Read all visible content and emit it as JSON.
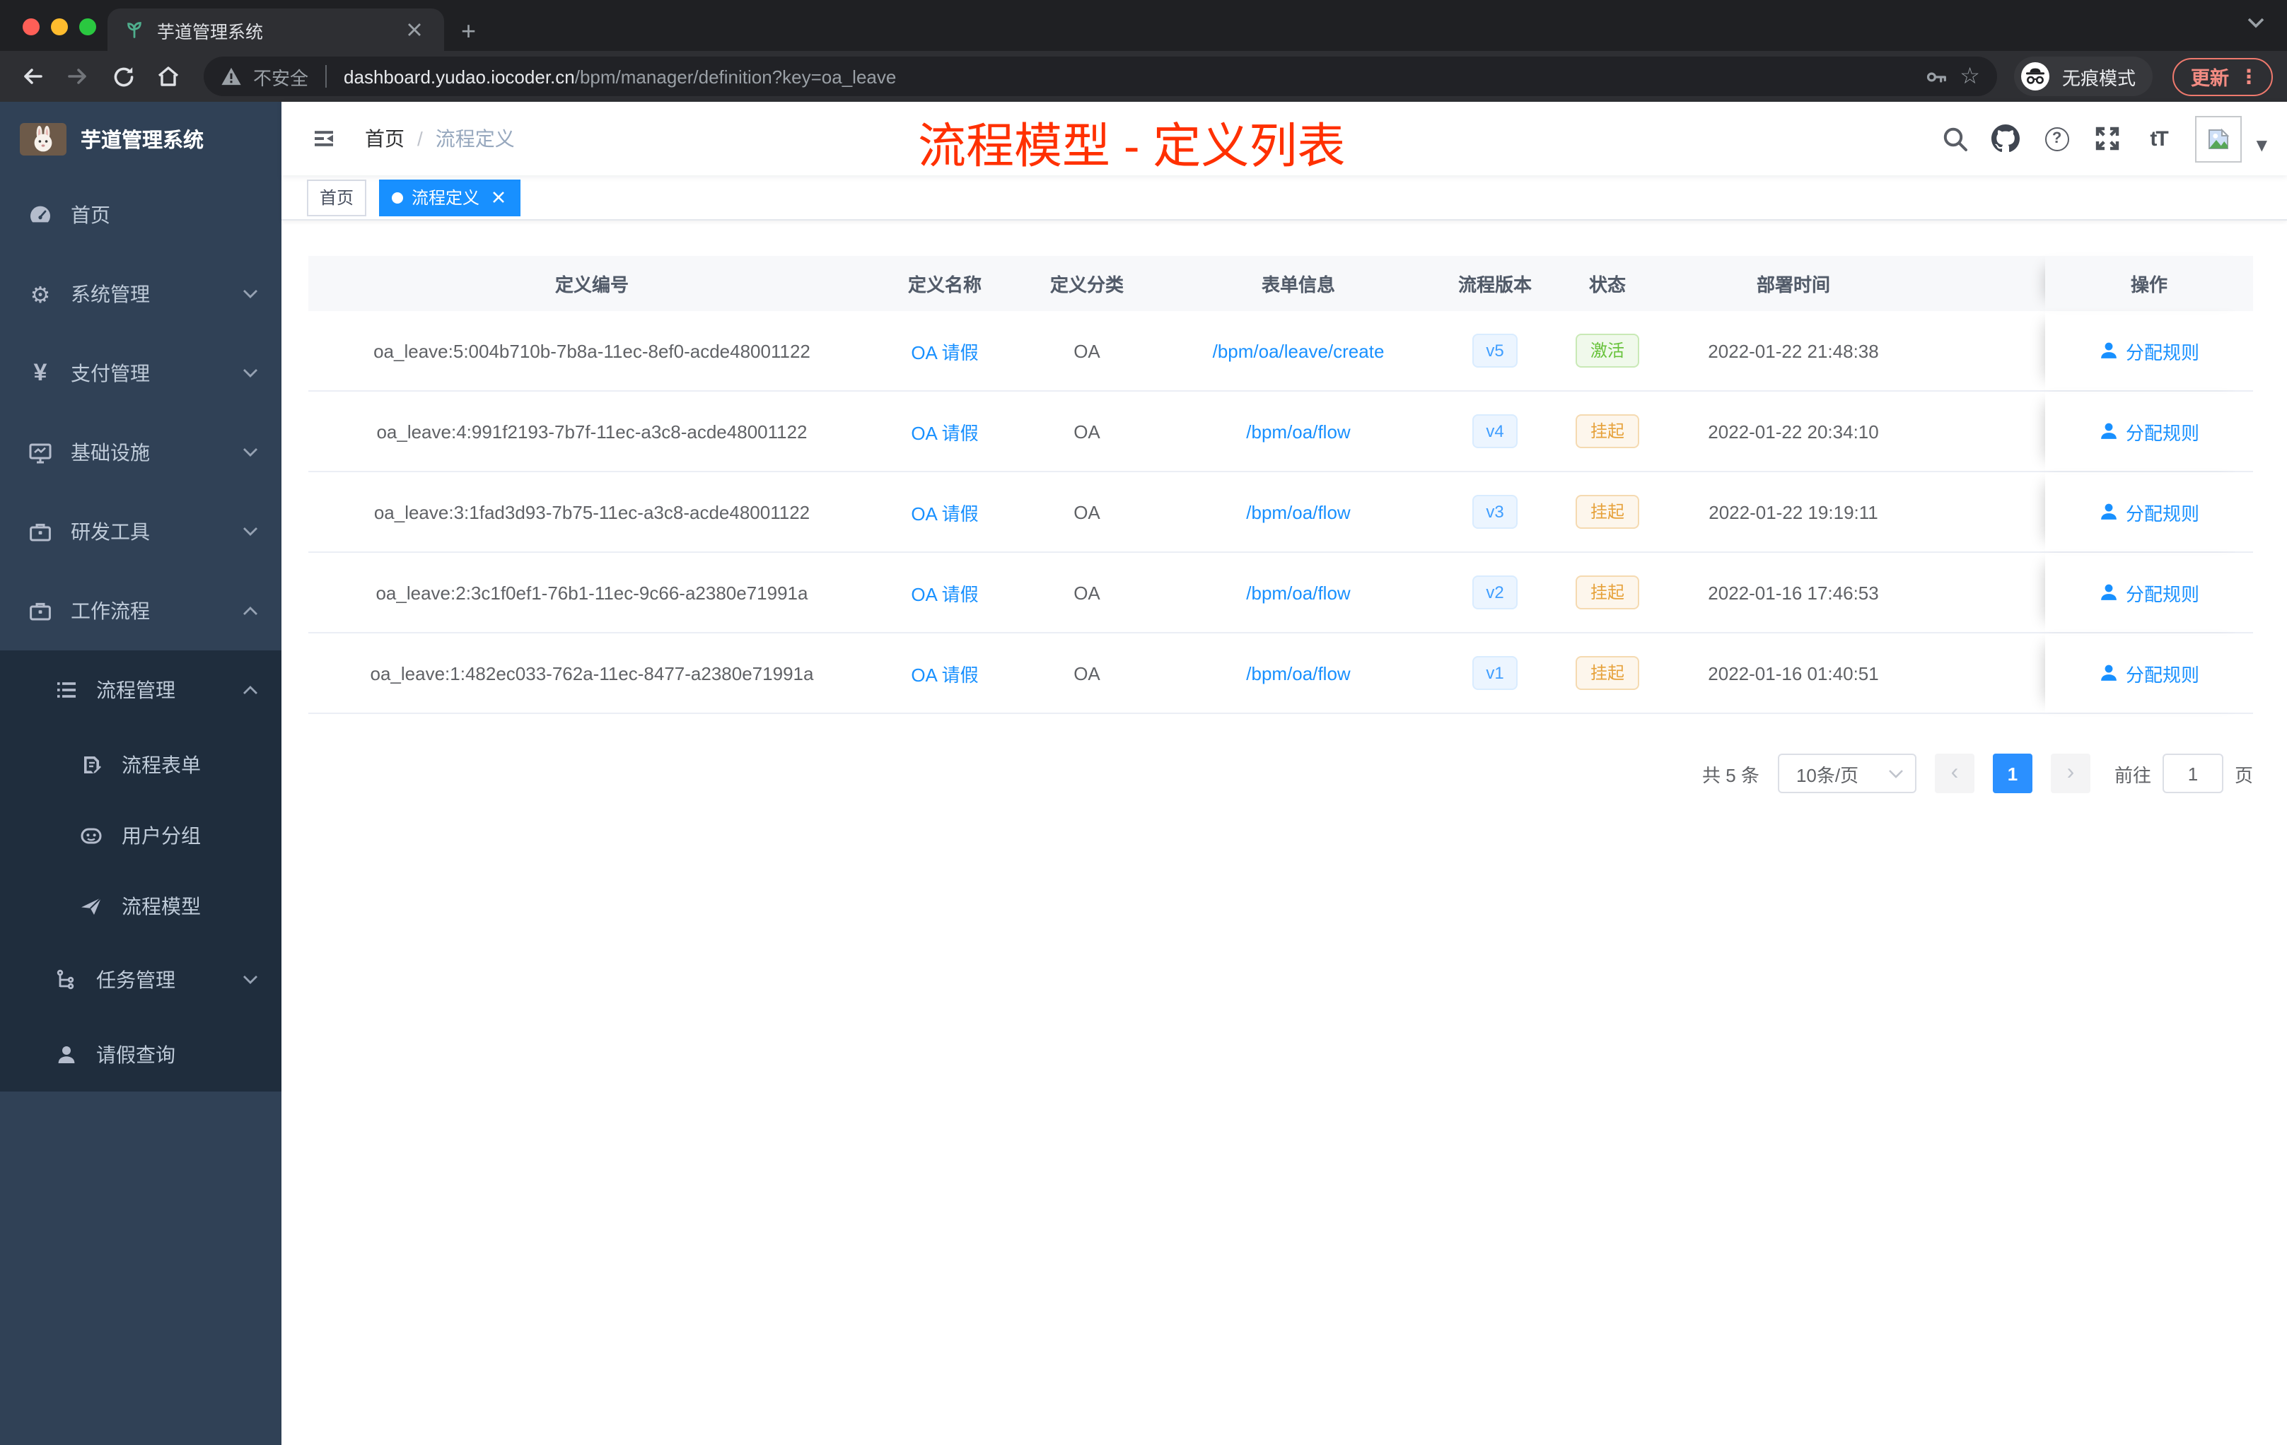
{
  "browser": {
    "tab_title": "芋道管理系统",
    "security_label": "不安全",
    "url_host": "dashboard.yudao.iocoder.cn",
    "url_path": "/bpm/manager/definition?key=oa_leave",
    "incognito_label": "无痕模式",
    "update_label": "更新"
  },
  "icons": {
    "plus": "+",
    "more": "⋮",
    "star": "☆",
    "gear": "⚙",
    "yen": "¥",
    "question": "?",
    "font_size": "tT",
    "caret_down": "▼",
    "prev": "‹",
    "next": "›",
    "close": "×",
    "names": [
      "sprout-favicon",
      "back-arrow",
      "forward-arrow",
      "reload",
      "home",
      "warning-triangle",
      "key",
      "star",
      "incognito",
      "search",
      "github",
      "question-circle",
      "fullscreen",
      "font-size",
      "avatar-broken-image",
      "caret-down",
      "hamburger",
      "dashboard",
      "gear",
      "yen",
      "monitor",
      "toolbox",
      "briefcase",
      "list",
      "form",
      "robot",
      "paper-plane",
      "tree",
      "user",
      "user-bust"
    ]
  },
  "sidebar": {
    "app_title": "芋道管理系统",
    "items": [
      {
        "label": "首页",
        "icon": "dashboard",
        "chevron": null
      },
      {
        "label": "系统管理",
        "icon": "gear",
        "chevron": "down"
      },
      {
        "label": "支付管理",
        "icon": "yen",
        "chevron": "down"
      },
      {
        "label": "基础设施",
        "icon": "monitor",
        "chevron": "down"
      },
      {
        "label": "研发工具",
        "icon": "toolbox",
        "chevron": "down"
      },
      {
        "label": "工作流程",
        "icon": "briefcase",
        "chevron": "up"
      },
      {
        "label": "流程管理",
        "icon": "list",
        "chevron": "up"
      },
      {
        "label": "流程表单",
        "icon": "form",
        "chevron": null
      },
      {
        "label": "用户分组",
        "icon": "robot",
        "chevron": null
      },
      {
        "label": "流程模型",
        "icon": "paper-plane",
        "chevron": null
      },
      {
        "label": "任务管理",
        "icon": "tree",
        "chevron": "down"
      },
      {
        "label": "请假查询",
        "icon": "user",
        "chevron": null
      }
    ]
  },
  "header": {
    "breadcrumb": [
      "首页",
      "流程定义"
    ],
    "breadcrumb_sep": "/",
    "annotation": "流程模型 - 定义列表"
  },
  "tags": {
    "items": [
      {
        "label": "首页",
        "active": false
      },
      {
        "label": "流程定义",
        "active": true
      }
    ]
  },
  "table": {
    "headers": [
      "定义编号",
      "定义名称",
      "定义分类",
      "表单信息",
      "流程版本",
      "状态",
      "部署时间",
      "操作"
    ],
    "rows": [
      {
        "id": "oa_leave:5:004b710b-7b8a-11ec-8ef0-acde48001122",
        "name": "OA 请假",
        "category": "OA",
        "form": "/bpm/oa/leave/create",
        "version": "v5",
        "status": "激活",
        "status_type": "success",
        "time": "2022-01-22 21:48:38",
        "action": "分配规则"
      },
      {
        "id": "oa_leave:4:991f2193-7b7f-11ec-a3c8-acde48001122",
        "name": "OA 请假",
        "category": "OA",
        "form": "/bpm/oa/flow",
        "version": "v4",
        "status": "挂起",
        "status_type": "warning",
        "time": "2022-01-22 20:34:10",
        "action": "分配规则"
      },
      {
        "id": "oa_leave:3:1fad3d93-7b75-11ec-a3c8-acde48001122",
        "name": "OA 请假",
        "category": "OA",
        "form": "/bpm/oa/flow",
        "version": "v3",
        "status": "挂起",
        "status_type": "warning",
        "time": "2022-01-22 19:19:11",
        "action": "分配规则"
      },
      {
        "id": "oa_leave:2:3c1f0ef1-76b1-11ec-9c66-a2380e71991a",
        "name": "OA 请假",
        "category": "OA",
        "form": "/bpm/oa/flow",
        "version": "v2",
        "status": "挂起",
        "status_type": "warning",
        "time": "2022-01-16 17:46:53",
        "action": "分配规则"
      },
      {
        "id": "oa_leave:1:482ec033-762a-11ec-8477-a2380e71991a",
        "name": "OA 请假",
        "category": "OA",
        "form": "/bpm/oa/flow",
        "version": "v1",
        "status": "挂起",
        "status_type": "warning",
        "time": "2022-01-16 01:40:51",
        "action": "分配规则"
      }
    ]
  },
  "pagination": {
    "total": "共 5 条",
    "page_size": "10条/页",
    "page": "1",
    "goto_label": "前往",
    "goto_value": "1",
    "page_unit": "页"
  },
  "colors": {
    "accent_blue": "#1890ff",
    "tag_blue": "#409eff",
    "success_green": "#67c23a",
    "warning_orange": "#e6a23c",
    "annotation_red": "#ff3000",
    "sidebar_bg": "#304156",
    "submenu_bg": "#1f2d3d"
  }
}
